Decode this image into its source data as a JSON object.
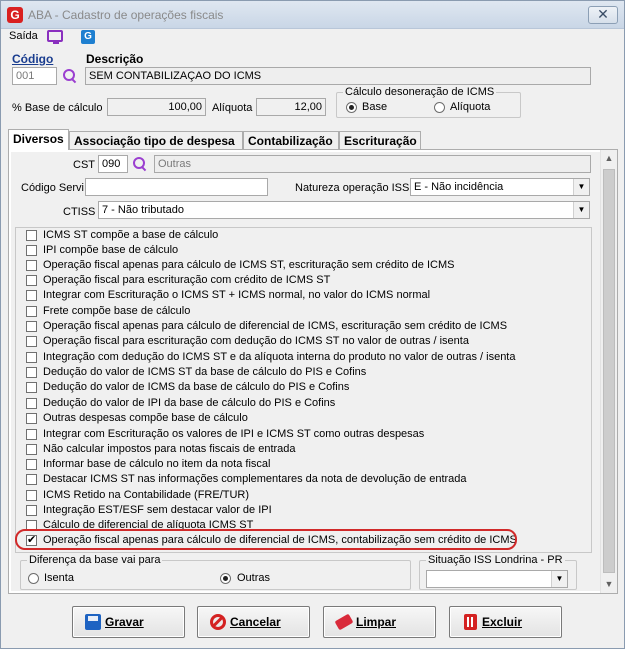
{
  "window": {
    "logo": "G",
    "title": "ABA - Cadastro de operações fiscais",
    "close": "✕"
  },
  "menu": {
    "saida": "Saída"
  },
  "header": {
    "codigo_label": "Código",
    "codigo_value": "001",
    "descricao_label": "Descrição",
    "descricao_value": "SEM CONTABILIZAÇAO DO ICMS",
    "base_label": "% Base de cálculo",
    "base_value": "100,00",
    "aliquota_label": "Alíquota",
    "aliquota_value": "12,00",
    "desoneracao_legend": "Cálculo desoneração de ICMS",
    "radio_base": "Base",
    "radio_aliquota": "Alíquota"
  },
  "tabs": [
    "Diversos",
    "Associação tipo de despesa",
    "Contabilização",
    "Escrituração"
  ],
  "diversos": {
    "cst_label": "CST",
    "cst_value": "090",
    "cst_desc": "Outras",
    "codigo_servico_label": "Código Servi",
    "codigo_servico_value": "",
    "natureza_label": "Natureza operação ISS",
    "natureza_value": "E - Não incidência",
    "ctiss_label": "CTISS",
    "ctiss_value": "7 - Não tributado"
  },
  "checkboxes": [
    {
      "label": "ICMS ST compõe a base de cálculo",
      "checked": false
    },
    {
      "label": "IPI compõe base de cálculo",
      "checked": false
    },
    {
      "label": "Operação fiscal apenas para cálculo de ICMS ST, escrituração sem crédito de ICMS",
      "checked": false
    },
    {
      "label": "Operação fiscal para escrituração com crédito de ICMS ST",
      "checked": false
    },
    {
      "label": "Integrar com Escrituração o ICMS ST + ICMS normal,  no valor do ICMS normal",
      "checked": false
    },
    {
      "label": "Frete compõe base de cálculo",
      "checked": false
    },
    {
      "label": "Operação fiscal apenas para cálculo de diferencial de ICMS, escrituração sem crédito de ICMS",
      "checked": false
    },
    {
      "label": "Operação fiscal para escrituração com dedução do ICMS ST no valor de outras / isenta",
      "checked": false
    },
    {
      "label": "Integração com dedução do ICMS ST e da alíquota interna do produto no valor de outras / isenta",
      "checked": false
    },
    {
      "label": "Dedução do valor de ICMS ST da base de cálculo do PIS e Cofins",
      "checked": false
    },
    {
      "label": "Dedução do valor de ICMS da base de cálculo do PIS e Cofins",
      "checked": false
    },
    {
      "label": "Dedução do valor de IPI da base de cálculo do PIS e Cofins",
      "checked": false
    },
    {
      "label": "Outras despesas compõe base de cálculo",
      "checked": false
    },
    {
      "label": "Integrar com Escrituração os valores de IPI e ICMS ST como outras despesas",
      "checked": false
    },
    {
      "label": "Não calcular impostos para notas fiscais de entrada",
      "checked": false
    },
    {
      "label": "Informar base de cálculo no item da nota fiscal",
      "checked": false
    },
    {
      "label": "Destacar ICMS ST nas informações complementares da nota de devolução de entrada",
      "checked": false
    },
    {
      "label": "ICMS Retido na Contabilidade (FRE/TUR)",
      "checked": false
    },
    {
      "label": "Integração EST/ESF sem destacar valor de IPI",
      "checked": false
    },
    {
      "label": "Cálculo de diferencial de alíquota ICMS ST",
      "checked": false
    },
    {
      "label": "Operação fiscal apenas para cálculo de diferencial de ICMS, contabilização sem crédito de ICMS",
      "checked": true
    }
  ],
  "diferenca": {
    "legend": "Diferença da base vai para",
    "isenta": "Isenta",
    "outras": "Outras"
  },
  "situacao": {
    "legend": "Situação ISS Londrina - PR",
    "value": ""
  },
  "buttons": {
    "gravar": "Gravar",
    "cancelar": "Cancelar",
    "limpar": "Limpar",
    "excluir": "Excluir"
  }
}
